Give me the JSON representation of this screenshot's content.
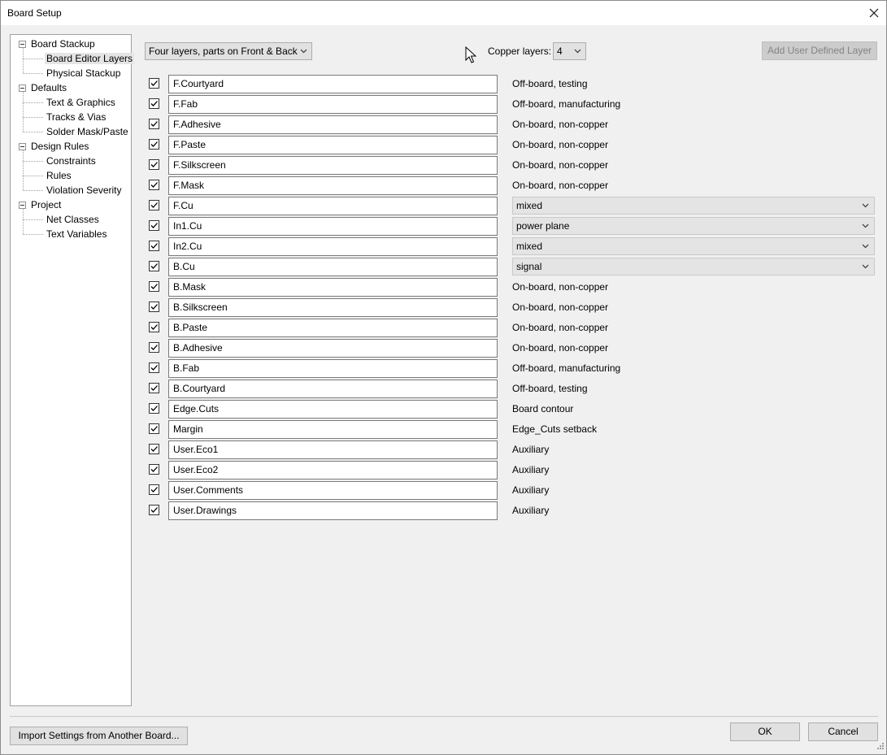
{
  "window": {
    "title": "Board Setup"
  },
  "tree": {
    "items": [
      {
        "label": "Board Stackup",
        "level": 0,
        "expanded": true
      },
      {
        "label": "Board Editor Layers",
        "level": 1,
        "selected": true
      },
      {
        "label": "Physical Stackup",
        "level": 1
      },
      {
        "label": "Defaults",
        "level": 0,
        "expanded": true
      },
      {
        "label": "Text & Graphics",
        "level": 1
      },
      {
        "label": "Tracks & Vias",
        "level": 1
      },
      {
        "label": "Solder Mask/Paste",
        "level": 1
      },
      {
        "label": "Design Rules",
        "level": 0,
        "expanded": true
      },
      {
        "label": "Constraints",
        "level": 1
      },
      {
        "label": "Rules",
        "level": 1
      },
      {
        "label": "Violation Severity",
        "level": 1
      },
      {
        "label": "Project",
        "level": 0,
        "expanded": true
      },
      {
        "label": "Net Classes",
        "level": 1
      },
      {
        "label": "Text Variables",
        "level": 1
      }
    ]
  },
  "toolbar": {
    "preset_value": "Four layers, parts on Front & Back",
    "copper_label": "Copper layers:",
    "copper_value": "4",
    "add_layer_label": "Add User Defined Layer"
  },
  "layers": [
    {
      "name": "F.Courtyard",
      "desc": "Off-board, testing",
      "checked": true
    },
    {
      "name": "F.Fab",
      "desc": "Off-board, manufacturing",
      "checked": true
    },
    {
      "name": "F.Adhesive",
      "desc": "On-board, non-copper",
      "checked": true
    },
    {
      "name": "F.Paste",
      "desc": "On-board, non-copper",
      "checked": true
    },
    {
      "name": "F.Silkscreen",
      "desc": "On-board, non-copper",
      "checked": true
    },
    {
      "name": "F.Mask",
      "desc": "On-board, non-copper",
      "checked": true
    },
    {
      "name": "F.Cu",
      "type": "mixed",
      "checked": true
    },
    {
      "name": "In1.Cu",
      "type": "power plane",
      "checked": true
    },
    {
      "name": "In2.Cu",
      "type": "mixed",
      "checked": true
    },
    {
      "name": "B.Cu",
      "type": "signal",
      "checked": true
    },
    {
      "name": "B.Mask",
      "desc": "On-board, non-copper",
      "checked": true
    },
    {
      "name": "B.Silkscreen",
      "desc": "On-board, non-copper",
      "checked": true
    },
    {
      "name": "B.Paste",
      "desc": "On-board, non-copper",
      "checked": true
    },
    {
      "name": "B.Adhesive",
      "desc": "On-board, non-copper",
      "checked": true
    },
    {
      "name": "B.Fab",
      "desc": "Off-board, manufacturing",
      "checked": true
    },
    {
      "name": "B.Courtyard",
      "desc": "Off-board, testing",
      "checked": true
    },
    {
      "name": "Edge.Cuts",
      "desc": "Board contour",
      "checked": true
    },
    {
      "name": "Margin",
      "desc": "Edge_Cuts setback",
      "checked": true
    },
    {
      "name": "User.Eco1",
      "desc": "Auxiliary",
      "checked": true
    },
    {
      "name": "User.Eco2",
      "desc": "Auxiliary",
      "checked": true
    },
    {
      "name": "User.Comments",
      "desc": "Auxiliary",
      "checked": true
    },
    {
      "name": "User.Drawings",
      "desc": "Auxiliary",
      "checked": true
    }
  ],
  "footer": {
    "import_label": "Import Settings from Another Board...",
    "ok_label": "OK",
    "cancel_label": "Cancel"
  }
}
